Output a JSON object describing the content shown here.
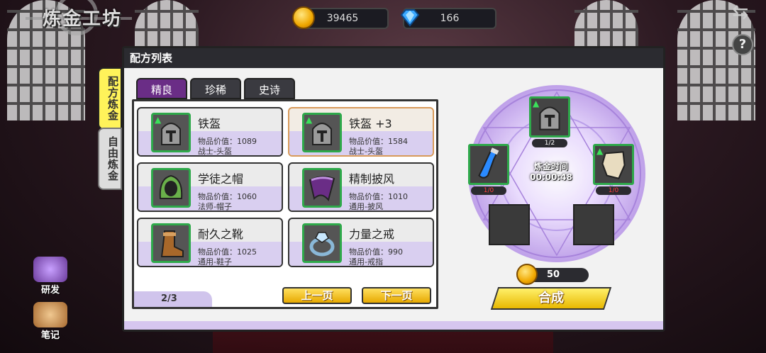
{
  "header": {
    "title": "炼金工坊"
  },
  "resources": {
    "gold": "39465",
    "diamonds": "166"
  },
  "panel": {
    "title": "配方列表"
  },
  "side_tabs": [
    "配方炼金",
    "自由炼金"
  ],
  "tabs": [
    "精良",
    "珍稀",
    "史诗"
  ],
  "recipes": [
    {
      "name": "铁盔",
      "value": "物品价值：1089",
      "class": "战士-头盔"
    },
    {
      "name": "铁盔 +3",
      "value": "物品价值：1584",
      "class": "战士-头盔"
    },
    {
      "name": "学徒之帽",
      "value": "物品价值：1060",
      "class": "法师-帽子"
    },
    {
      "name": "精制披风",
      "value": "物品价值：1010",
      "class": "通用-披风"
    },
    {
      "name": "耐久之靴",
      "value": "物品价值：1025",
      "class": "通用-鞋子"
    },
    {
      "name": "力量之戒",
      "value": "物品价值：990",
      "class": "通用-戒指"
    }
  ],
  "pagination": {
    "page": "2/3",
    "prev": "上一页",
    "next": "下一页"
  },
  "alchemy": {
    "top_count": "1/2",
    "left_count": "1/0",
    "right_count": "1/0",
    "timer_label": "炼金时间",
    "timer_value": "00:00:48",
    "cost": "50",
    "synth_label": "合成"
  },
  "left_menu": {
    "research": "研发",
    "notes": "笔记"
  },
  "colors": {
    "accent_purple": "#6a2d86",
    "gold": "#f0a800",
    "green_frame": "#2ea84a"
  },
  "icons": {
    "help": "?",
    "back": "⇆"
  }
}
